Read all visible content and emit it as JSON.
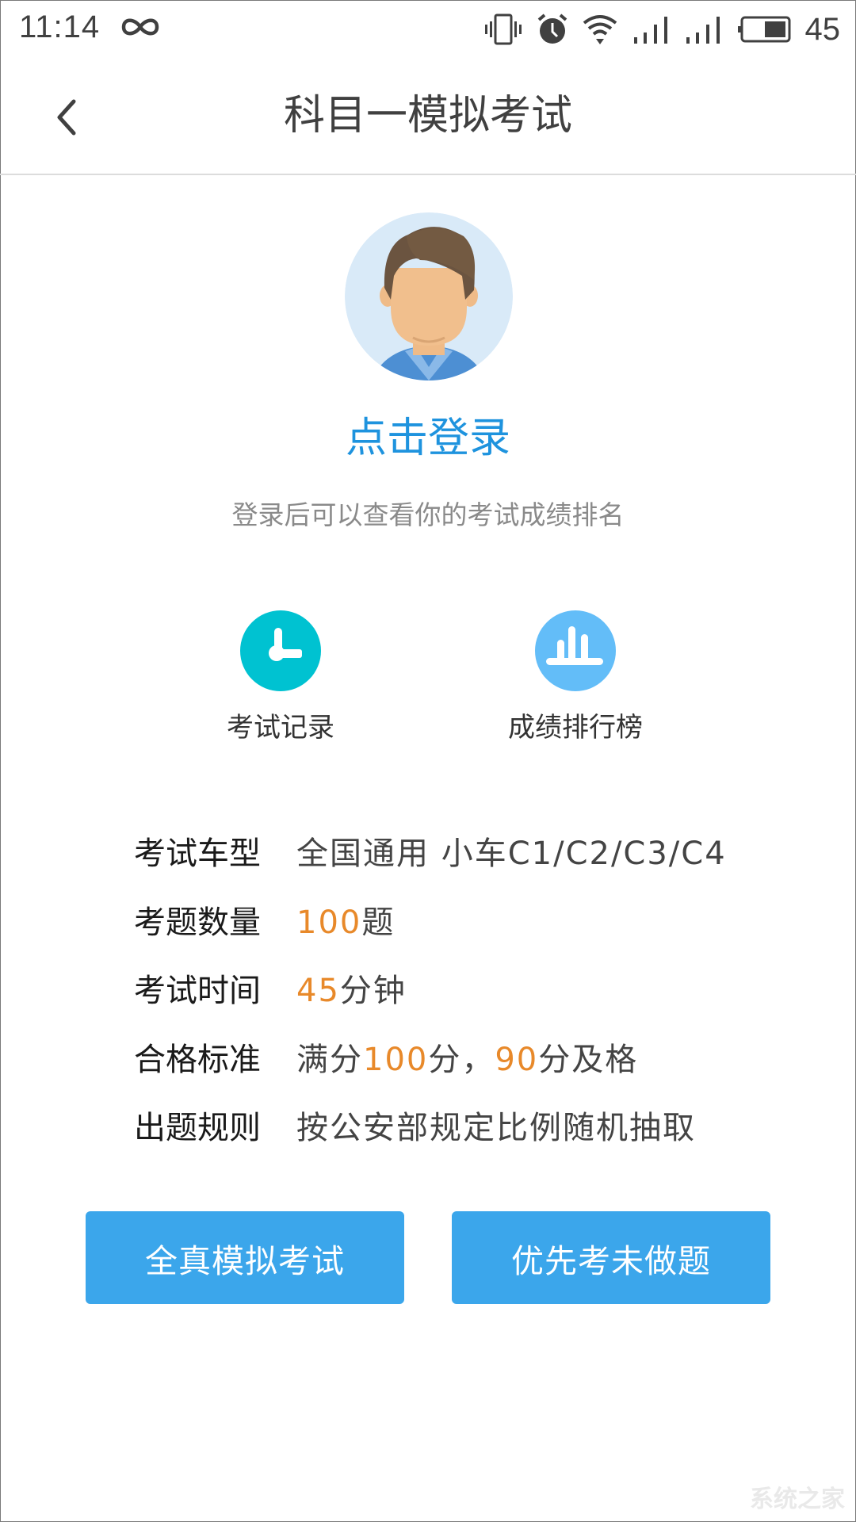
{
  "status_bar": {
    "time": "11:14",
    "icons": [
      "infinity-icon",
      "vibrate-icon",
      "alarm-icon",
      "wifi-icon",
      "signal-icon",
      "signal-icon",
      "battery-icon"
    ],
    "battery_level": "45"
  },
  "header": {
    "back_icon": "chevron-left-icon",
    "title": "科目一模拟考试"
  },
  "profile": {
    "avatar_icon": "default-avatar",
    "login_label": "点击登录",
    "login_hint": "登录后可以查看你的考试成绩排名"
  },
  "shortcuts": [
    {
      "icon": "clock-icon",
      "label": "考试记录",
      "color": "#00c2d1"
    },
    {
      "icon": "bar-chart-icon",
      "label": "成绩排行榜",
      "color": "#63bdf8"
    }
  ],
  "info": {
    "vehicle": {
      "label": "考试车型",
      "value": "全国通用 小车C1/C2/C3/C4"
    },
    "count": {
      "label": "考题数量",
      "num": "100",
      "suffix": "题"
    },
    "time": {
      "label": "考试时间",
      "num": "45",
      "suffix": "分钟"
    },
    "pass": {
      "label": "合格标准",
      "prefix": "满分",
      "full": "100",
      "mid": "分，",
      "pass": "90",
      "suffix": "分及格"
    },
    "rule": {
      "label": "出题规则",
      "value": "按公安部规定比例随机抽取"
    }
  },
  "buttons": {
    "full_exam": "全真模拟考试",
    "undone_first": "优先考未做题"
  },
  "colors": {
    "accent": "#3ba6eb",
    "login_text": "#1e93de",
    "highlight": "#e8892a"
  },
  "watermark": "系统之家"
}
